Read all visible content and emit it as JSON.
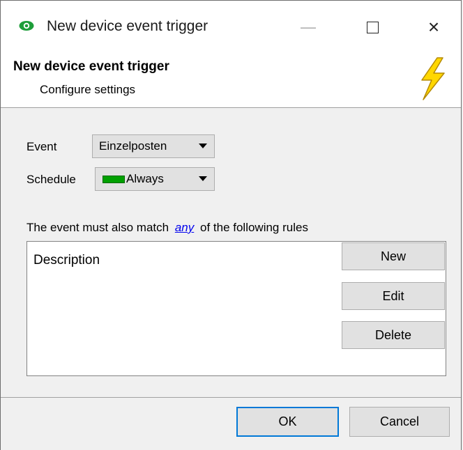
{
  "window": {
    "title": "New device event trigger",
    "controls": {
      "minimize": "—",
      "close": "×"
    }
  },
  "header": {
    "title": "New device event trigger",
    "subtitle": "Configure settings"
  },
  "form": {
    "event_label": "Event",
    "event_value": "Einzelposten",
    "schedule_label": "Schedule",
    "schedule_value": "Always",
    "schedule_color": "#00a000"
  },
  "rules": {
    "prefix": "The event must also match",
    "match_mode": "any",
    "suffix": "of the following rules",
    "column_header": "Description",
    "buttons": {
      "new": "New",
      "edit": "Edit",
      "delete": "Delete"
    }
  },
  "footer": {
    "ok": "OK",
    "cancel": "Cancel"
  },
  "colors": {
    "accent": "#0078d7",
    "link": "#0000ee",
    "bolt": "#ffd700"
  }
}
